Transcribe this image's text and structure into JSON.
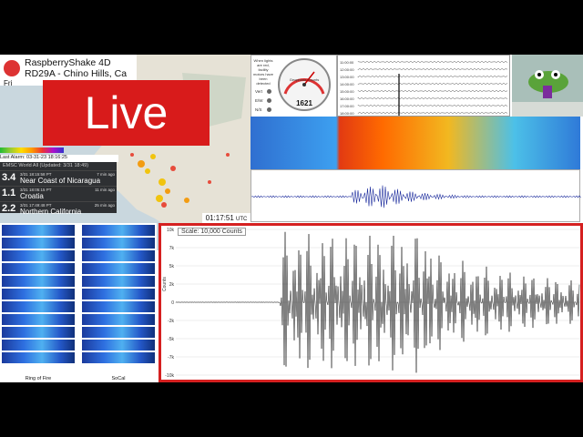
{
  "header": {
    "title": "RaspberryShake 4D",
    "subtitle": "RD29A - Chino Hills, Ca",
    "day": "Fri"
  },
  "banner": {
    "label": "Live"
  },
  "alarm": {
    "text": "Last Alarm: 03-31-23 18:16:25"
  },
  "quake_feed": {
    "heading": "EMSC World All (Updated: 3/31 18:49)",
    "items": [
      {
        "mag": "3.4",
        "time": "3/31 18:15:58 PT",
        "depth": "33km",
        "place": "Near Coast of Nicaragua",
        "ago": "7 min ago"
      },
      {
        "mag": "1.1",
        "time": "3/31 18:05:15 PT",
        "depth": "9km",
        "place": "Croatia",
        "ago": "11 min ago"
      },
      {
        "mag": "2.2",
        "time": "3/31 17:49:48 PT",
        "depth": "4km",
        "place": "Northern California",
        "ago": "25 min ago"
      }
    ]
  },
  "clock": {
    "time": "01:17:51",
    "zone": "UTC"
  },
  "gauge": {
    "title": "Geophone Counts",
    "value": "1621",
    "left_labels": [
      "When lights",
      "are red,",
      "facility",
      "motors have",
      "been",
      "detected"
    ],
    "channels": [
      "Vert",
      "E/W",
      "N/S"
    ]
  },
  "helicorder": {
    "times": [
      "11:00:00",
      "12:00:00",
      "13:00:00",
      "14:00:00",
      "15:00:00",
      "16:00:00",
      "17:00:00",
      "18:00:00"
    ]
  },
  "spectrogram_panels": {
    "left_label": "Ring of Fire",
    "right_label": "SoCal"
  },
  "seismogram": {
    "scale_label": "Scale: 10,000 Counts",
    "y_axis_label": "Counts",
    "y_ticks": [
      "10k",
      "7k",
      "5k",
      "2k",
      "0",
      "-2k",
      "-5k",
      "-7k",
      "-10k"
    ]
  },
  "colors": {
    "accent": "#d81b1b",
    "panel": "#2e3033"
  }
}
